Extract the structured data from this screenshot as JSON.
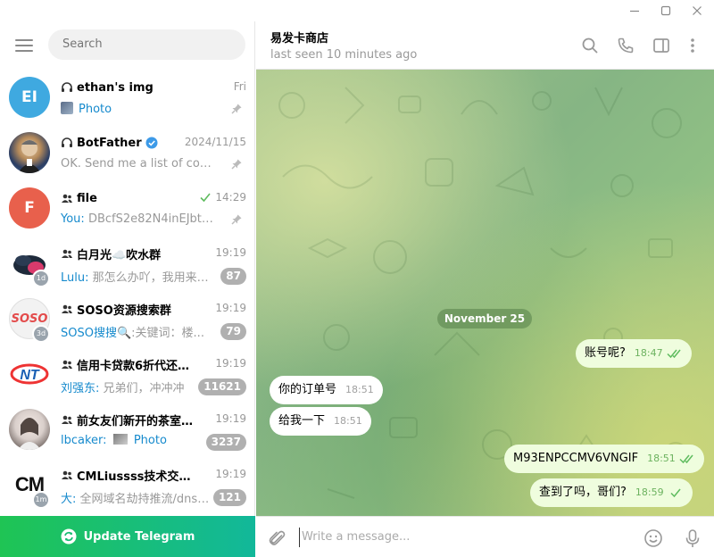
{
  "window": {
    "controls": [
      "minimize",
      "maximize",
      "close"
    ]
  },
  "sidebar": {
    "search_placeholder": "Search",
    "chats": [
      {
        "name": "ethan's img",
        "time": "Fri",
        "sender": "",
        "preview": "Photo",
        "avatar_text": "EI",
        "avatar_color": "#3fa9e0",
        "icon": "headphones-icon",
        "pinned": true,
        "unread": ""
      },
      {
        "name": "BotFather",
        "time": "2024/11/15",
        "sender": "",
        "preview": "OK. Send me a list of comma...",
        "avatar_text": "",
        "avatar_color": "#4a6fa5",
        "icon": "headphones-icon",
        "verified": true,
        "pinned": true,
        "unread": ""
      },
      {
        "name": "file",
        "time": "14:29",
        "sender": "You:",
        "preview": "DBcfS2e82N4inEJbtktZ2...",
        "avatar_text": "F",
        "avatar_color": "#e8604c",
        "icon": "group-icon",
        "pinned": true,
        "read": true,
        "unread": ""
      },
      {
        "name": "白月光☁️吹水群",
        "time": "19:19",
        "sender": "Lulu:",
        "preview": "那怎么办吖，我用来激...",
        "avatar_text": "",
        "avatar_color": "#1e2a3a",
        "icon": "group-icon",
        "subbadge": "1d",
        "unread": "87"
      },
      {
        "name": "SOSO资源搜索群",
        "time": "19:19",
        "sender": "SOSO搜搜",
        "preview": "🔍:关键词：楼...",
        "avatar_text": "SOSO",
        "avatar_color": "#f5f5f5",
        "icon": "group-icon",
        "subbadge": "3d",
        "unread": "79"
      },
      {
        "name": "信用卡贷款6折代还、7...",
        "time": "19:19",
        "sender": "刘强东:",
        "preview": "兄弟们，冲冲冲",
        "avatar_text": "",
        "avatar_color": "#ffffff",
        "icon": "group-icon",
        "unread": "11621"
      },
      {
        "name": "前女友们新开的茶室 | ...",
        "time": "19:19",
        "sender": "lbcaker:",
        "preview": "Photo",
        "avatar_text": "",
        "avatar_color": "#d9cfcb",
        "icon": "group-icon",
        "unread": "3237"
      },
      {
        "name": "CMLiussss技术交流群",
        "time": "19:19",
        "sender": "大:",
        "preview": "全网域名劫持推流/dns劫...",
        "avatar_text": "CM",
        "avatar_color": "#ffffff",
        "icon": "group-icon",
        "subbadge": "1m",
        "unread": "121"
      }
    ],
    "update_label": "Update Telegram"
  },
  "chat": {
    "title": "易发卡商店",
    "status": "last seen 10 minutes ago",
    "date_separator": "November 25",
    "messages": [
      {
        "direction": "out",
        "text": "账号呢?",
        "time": "18:47",
        "status": "read"
      },
      {
        "direction": "in",
        "text": "你的订单号",
        "time": "18:51"
      },
      {
        "direction": "in",
        "text": "给我一下",
        "time": "18:51"
      },
      {
        "direction": "out",
        "text": "M93ENPCCMV6VNGIF",
        "time": "18:51",
        "status": "read"
      },
      {
        "direction": "out",
        "text": "查到了吗，哥们?",
        "time": "18:59",
        "status": "sent"
      }
    ],
    "composer_placeholder": "Write a message..."
  },
  "colors": {
    "accent": "#168acd",
    "update_gradient_start": "#1fc454",
    "update_gradient_end": "#12b89a",
    "outgoing_bubble": "#effdde",
    "tick_green": "#5fbc5f"
  }
}
